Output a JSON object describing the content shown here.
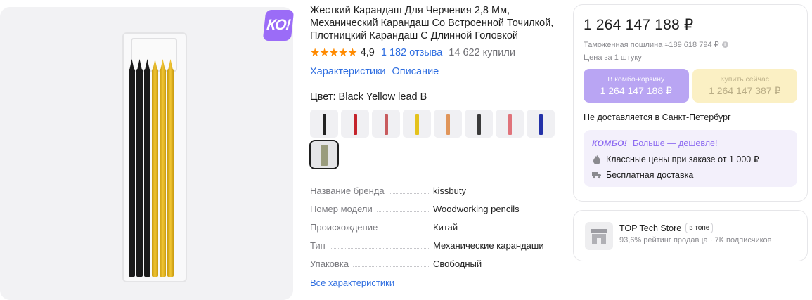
{
  "product": {
    "badge": "КО!",
    "title": "Жесткий Карандаш Для Черчения 2,8 Мм, Механический Карандаш Со Встроенной Точилкой, Плотницкий Карандаш С Длинной Головкой",
    "stars": "★★★★★",
    "rating": "4,9",
    "reviews": "1 182 отзыва",
    "bought": "14 622 купили",
    "links": {
      "characteristics": "Характеристики",
      "description": "Описание"
    },
    "color_label": "Цвет: Black Yellow lead B",
    "swatches": [
      {
        "name": "swatch-black-pencil",
        "color": "#222222"
      },
      {
        "name": "swatch-red-pencil",
        "color": "#c4232b"
      },
      {
        "name": "swatch-red-lead",
        "color": "#c85b5e"
      },
      {
        "name": "swatch-yellow-pencil",
        "color": "#e4c21c"
      },
      {
        "name": "swatch-orange-lead",
        "color": "#e0955a"
      },
      {
        "name": "swatch-dark-lead",
        "color": "#3b3b3b"
      },
      {
        "name": "swatch-pink-lead",
        "color": "#e0737b"
      },
      {
        "name": "swatch-blue-pencil",
        "color": "#2432a8"
      },
      {
        "name": "swatch-black-yellow-lead",
        "color": "#9a9c7d"
      }
    ],
    "specs": [
      {
        "key": "Название бренда",
        "value": "kissbuty"
      },
      {
        "key": "Номер модели",
        "value": "Woodworking pencils"
      },
      {
        "key": "Происхождение",
        "value": "Китай"
      },
      {
        "key": "Тип",
        "value": "Механические карандаши"
      },
      {
        "key": "Упаковка",
        "value": "Свободный"
      }
    ],
    "all_specs": "Все характеристики"
  },
  "buybox": {
    "price": "1 264 147 188 ₽",
    "duty": "Таможенная пошлина ≈189 618 794 ₽",
    "per_unit": "Цена за 1 штуку",
    "combo_button": {
      "caption": "В комбо-корзину",
      "amount": "1 264 147 188 ₽"
    },
    "buy_button": {
      "caption": "Купить сейчас",
      "amount": "1 264 147 387 ₽"
    },
    "delivery": "Не доставляется в Санкт-Петербург",
    "combo": {
      "logo": "КОМБО!",
      "headline": "Больше — дешевле!",
      "line1": "Классные цены при заказе от 1 000 ₽",
      "line2": "Бесплатная доставка"
    }
  },
  "seller": {
    "name": "TOP Tech Store",
    "tag": "в топе",
    "meta": "93,6% рейтинг продавца · 7K подписчиков"
  }
}
